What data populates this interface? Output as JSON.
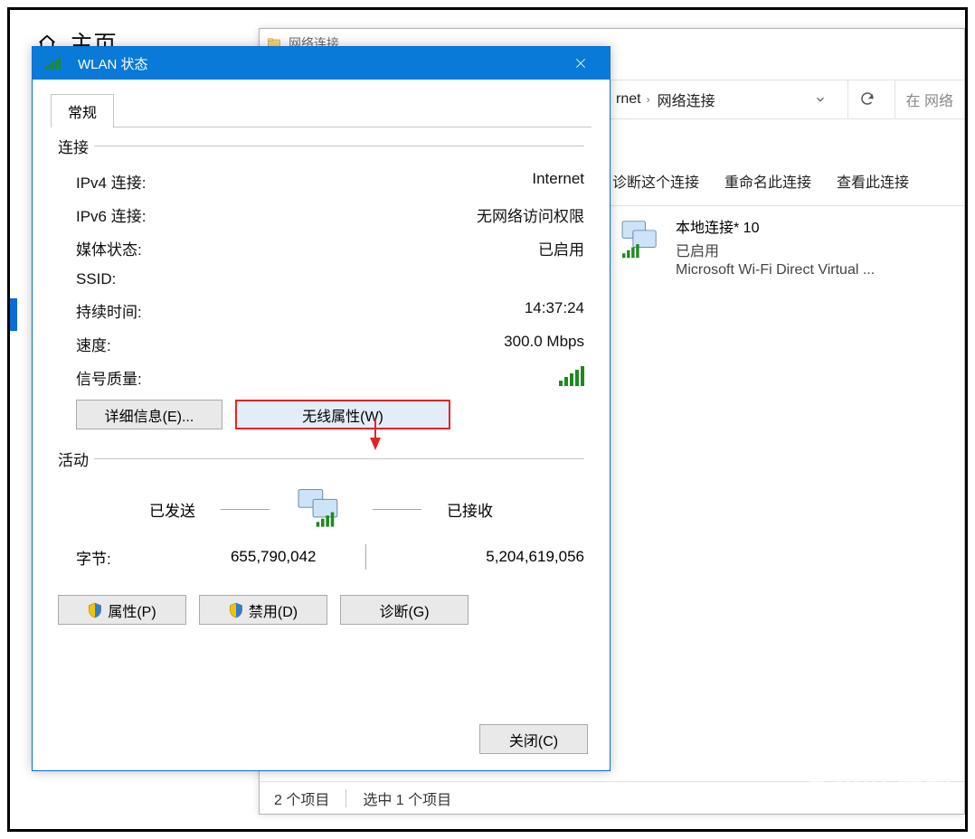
{
  "bg": {
    "home_label": "主页"
  },
  "net_window": {
    "title": "网络连接",
    "breadcrumb_parent_suffix": "rnet",
    "breadcrumb_current": "网络连接",
    "search_placeholder": "在 网络",
    "toolbar": {
      "diagnose": "诊断这个连接",
      "rename": "重命名此连接",
      "view": "查看此连接"
    },
    "item": {
      "name": "本地连接* 10",
      "status": "已启用",
      "adapter": "Microsoft Wi-Fi Direct Virtual ..."
    },
    "status_bar": {
      "count": "2 个项目",
      "selected": "选中 1 个项目"
    }
  },
  "wlan": {
    "title": "WLAN 状态",
    "tab_general": "常规",
    "group_connection": "连接",
    "fields": {
      "ipv4_k": "IPv4 连接:",
      "ipv4_v": "Internet",
      "ipv6_k": "IPv6 连接:",
      "ipv6_v": "无网络访问权限",
      "media_k": "媒体状态:",
      "media_v": "已启用",
      "ssid_k": "SSID:",
      "ssid_v": "",
      "duration_k": "持续时间:",
      "duration_v": "14:37:24",
      "speed_k": "速度:",
      "speed_v": "300.0 Mbps",
      "signal_k": "信号质量:"
    },
    "buttons": {
      "details": "详细信息(E)...",
      "wireless_props": "无线属性(W)",
      "properties": "属性(P)",
      "disable": "禁用(D)",
      "diagnose": "诊断(G)",
      "close": "关闭(C)"
    },
    "group_activity": "活动",
    "activity": {
      "sent_label": "已发送",
      "recv_label": "已接收",
      "bytes_k": "字节:",
      "bytes_sent": "655,790,042",
      "bytes_recv": "5,204,619,056"
    }
  },
  "watermark": {
    "line1": "Baidu 经验",
    "line2": "jingyan.baidu.com"
  }
}
